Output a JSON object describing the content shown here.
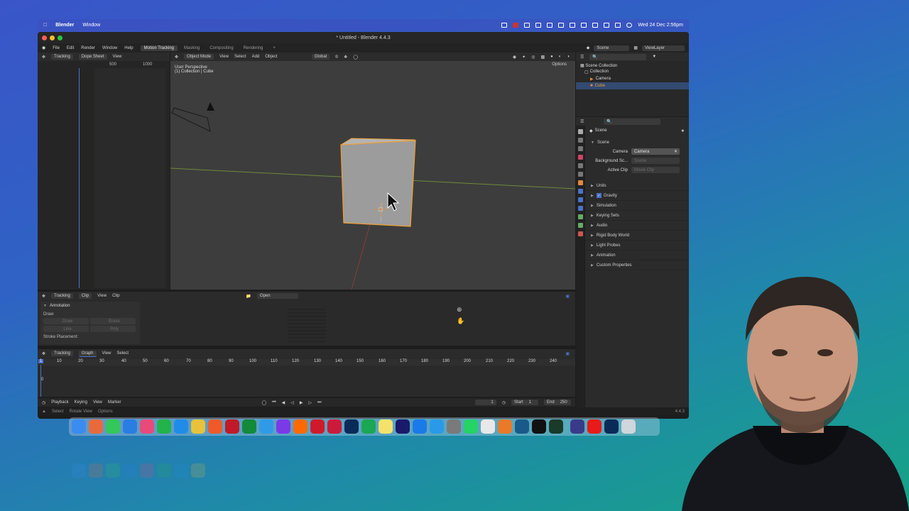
{
  "menubar": {
    "app": "Blender",
    "menu": [
      "Window"
    ],
    "datetime": "Wed 24 Dec 2:56pm"
  },
  "window": {
    "title": "* Untitled - Blender 4.4.3"
  },
  "topbar": {
    "menus": [
      "File",
      "Edit",
      "Render",
      "Window",
      "Help"
    ],
    "workspaces": [
      "Motion Tracking",
      "Masking",
      "Compositing",
      "Rendering"
    ],
    "active_workspace": "Motion Tracking",
    "add_tab": "+",
    "scene": "Scene",
    "view_layer": "ViewLayer"
  },
  "dopesheet": {
    "editor": "Tracking",
    "mode": "Dope Sheet",
    "menu": "View",
    "ruler": [
      "500",
      "1000"
    ]
  },
  "viewport": {
    "mode": "Object Mode",
    "menus": [
      "View",
      "Select",
      "Add",
      "Object"
    ],
    "transform": "Global",
    "options": "Options",
    "overlay_line1": "User Perspective",
    "overlay_line2": "(1) Collection | Cube"
  },
  "outliner": {
    "root": "Scene Collection",
    "collection": "Collection",
    "items": [
      "Camera",
      "Cube"
    ]
  },
  "properties": {
    "breadcrumb": "Scene",
    "section": "Scene",
    "camera_label": "Camera",
    "camera_value": "Camera",
    "bg_label": "Background Sc...",
    "bg_placeholder": "Scene",
    "clip_label": "Active Clip",
    "clip_placeholder": "Movie Clip",
    "panels": [
      "Units",
      "Gravity",
      "Simulation",
      "Keying Sets",
      "Audio",
      "Rigid Body World",
      "Light Probes",
      "Animation",
      "Custom Properties"
    ],
    "gravity_checked": true
  },
  "clip_editor": {
    "editor": "Tracking",
    "mode": "Clip",
    "menus": [
      "View",
      "Clip"
    ],
    "open": "Open",
    "annotation": "Annotation",
    "draw": "Draw:",
    "tools": [
      "Draw",
      "Erase",
      "Line",
      "Poly"
    ],
    "stroke": "Stroke Placement:"
  },
  "graph": {
    "editor": "Tracking",
    "mode": "Graph",
    "menus": [
      "View",
      "Select"
    ],
    "ruler": [
      "10",
      "20",
      "30",
      "40",
      "50",
      "60",
      "70",
      "80",
      "90",
      "100",
      "110",
      "120",
      "130",
      "140",
      "150",
      "160",
      "170",
      "180",
      "190",
      "200",
      "210",
      "220",
      "230",
      "240"
    ],
    "current": "1",
    "zero": "0"
  },
  "timeline": {
    "menus": [
      "Playback",
      "Keying",
      "View",
      "Marker"
    ],
    "frame": "1",
    "start_label": "Start",
    "start": "1",
    "end_label": "End",
    "end": "250"
  },
  "statusbar": {
    "items": [
      "Select",
      "Rotate View",
      "Options"
    ],
    "version": "4.4.3"
  },
  "colors": {
    "accent": "#4a72c8",
    "selection": "#f0a030",
    "active_ws": "#3d3d3d"
  }
}
